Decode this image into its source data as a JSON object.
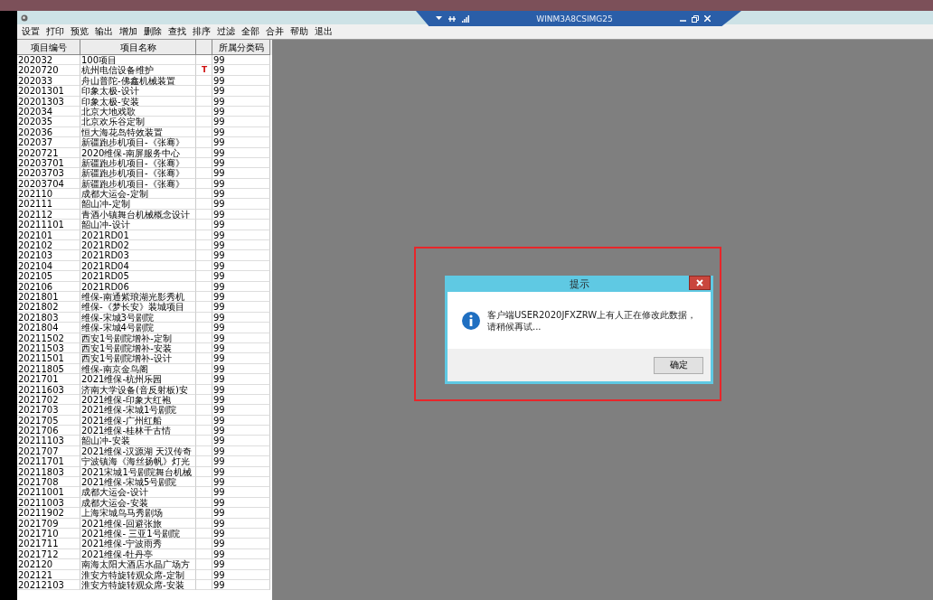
{
  "remote_bar": {
    "title": "WINM3A8CSIMG25"
  },
  "menu": [
    "设置",
    "打印",
    "预览",
    "输出",
    "增加",
    "删除",
    "查找",
    "排序",
    "过滤",
    "全部",
    "合并",
    "帮助",
    "退出"
  ],
  "table": {
    "columns": [
      "项目编号",
      "项目名称",
      "所属分类码"
    ],
    "rows": [
      {
        "code": "202032",
        "name": "100项目",
        "flag": "",
        "category": "99"
      },
      {
        "code": "2020720",
        "name": "杭州电信设备维护",
        "flag": "T",
        "category": "99"
      },
      {
        "code": "202033",
        "name": "舟山普陀-佛鑫机械装置",
        "flag": "",
        "category": "99"
      },
      {
        "code": "20201301",
        "name": "印象太极-设计",
        "flag": "",
        "category": "99"
      },
      {
        "code": "20201303",
        "name": "印象太极-安装",
        "flag": "",
        "category": "99"
      },
      {
        "code": "202034",
        "name": "北京大地戏歌",
        "flag": "",
        "category": "99"
      },
      {
        "code": "202035",
        "name": "北京欢乐谷定制",
        "flag": "",
        "category": "99"
      },
      {
        "code": "202036",
        "name": "恒大海花岛特效装置",
        "flag": "",
        "category": "99"
      },
      {
        "code": "202037",
        "name": "新疆跑步机项目-《张骞》",
        "flag": "",
        "category": "99"
      },
      {
        "code": "2020721",
        "name": "2020维保-南屏服务中心",
        "flag": "",
        "category": "99"
      },
      {
        "code": "20203701",
        "name": "新疆跑步机项目-《张骞》",
        "flag": "",
        "category": "99"
      },
      {
        "code": "20203703",
        "name": "新疆跑步机项目-《张骞》",
        "flag": "",
        "category": "99"
      },
      {
        "code": "20203704",
        "name": "新疆跑步机项目-《张骞》",
        "flag": "",
        "category": "99"
      },
      {
        "code": "202110",
        "name": "成都大运会-定制",
        "flag": "",
        "category": "99"
      },
      {
        "code": "202111",
        "name": "韶山冲-定制",
        "flag": "",
        "category": "99"
      },
      {
        "code": "202112",
        "name": "青酒小镇舞台机械概念设计",
        "flag": "",
        "category": "99"
      },
      {
        "code": "20211101",
        "name": "韶山冲-设计",
        "flag": "",
        "category": "99"
      },
      {
        "code": "202101",
        "name": "2021RD01",
        "flag": "",
        "category": "99"
      },
      {
        "code": "202102",
        "name": "2021RD02",
        "flag": "",
        "category": "99"
      },
      {
        "code": "202103",
        "name": "2021RD03",
        "flag": "",
        "category": "99"
      },
      {
        "code": "202104",
        "name": "2021RD04",
        "flag": "",
        "category": "99"
      },
      {
        "code": "202105",
        "name": "2021RD05",
        "flag": "",
        "category": "99"
      },
      {
        "code": "202106",
        "name": "2021RD06",
        "flag": "",
        "category": "99"
      },
      {
        "code": "2021801",
        "name": "维保-南通紫琅湖光影秀机",
        "flag": "",
        "category": "99"
      },
      {
        "code": "2021802",
        "name": "维保-《梦长安》装城项目",
        "flag": "",
        "category": "99"
      },
      {
        "code": "2021803",
        "name": "维保-宋城3号剧院",
        "flag": "",
        "category": "99"
      },
      {
        "code": "2021804",
        "name": "维保-宋城4号剧院",
        "flag": "",
        "category": "99"
      },
      {
        "code": "20211502",
        "name": "西安1号剧院增补-定制",
        "flag": "",
        "category": "99"
      },
      {
        "code": "20211503",
        "name": "西安1号剧院增补-安装",
        "flag": "",
        "category": "99"
      },
      {
        "code": "20211501",
        "name": "西安1号剧院增补-设计",
        "flag": "",
        "category": "99"
      },
      {
        "code": "20211805",
        "name": "维保-南京金鸟阁",
        "flag": "",
        "category": "99"
      },
      {
        "code": "2021701",
        "name": "2021维保-杭州乐园",
        "flag": "",
        "category": "99"
      },
      {
        "code": "20211603",
        "name": "济南大学设备(音反射板)安",
        "flag": "",
        "category": "99"
      },
      {
        "code": "2021702",
        "name": "2021维保-印象大红袍",
        "flag": "",
        "category": "99"
      },
      {
        "code": "2021703",
        "name": "2021维保-宋城1号剧院",
        "flag": "",
        "category": "99"
      },
      {
        "code": "2021705",
        "name": "2021维保-广州红船",
        "flag": "",
        "category": "99"
      },
      {
        "code": "2021706",
        "name": "2021维保-桂林千古情",
        "flag": "",
        "category": "99"
      },
      {
        "code": "20211103",
        "name": "韶山冲-安装",
        "flag": "",
        "category": "99"
      },
      {
        "code": "2021707",
        "name": "2021维保-汉源湖 天汉传奇",
        "flag": "",
        "category": "99"
      },
      {
        "code": "20211701",
        "name": "宁波镇海《海丝扬帆》灯光",
        "flag": "",
        "category": "99"
      },
      {
        "code": "20211803",
        "name": "2021宋城1号剧院舞台机械",
        "flag": "",
        "category": "99"
      },
      {
        "code": "2021708",
        "name": "2021维保-宋城5号剧院",
        "flag": "",
        "category": "99"
      },
      {
        "code": "20211001",
        "name": "成都大运会-设计",
        "flag": "",
        "category": "99"
      },
      {
        "code": "20211003",
        "name": "成都大运会-安装",
        "flag": "",
        "category": "99"
      },
      {
        "code": "20211902",
        "name": "上海宋城鸟马秀剧场",
        "flag": "",
        "category": "99"
      },
      {
        "code": "2021709",
        "name": "2021维保-回避张旅",
        "flag": "",
        "category": "99"
      },
      {
        "code": "2021710",
        "name": "2021维保- 三亚1号剧院",
        "flag": "",
        "category": "99"
      },
      {
        "code": "2021711",
        "name": "2021维保-宁波雨秀",
        "flag": "",
        "category": "99"
      },
      {
        "code": "2021712",
        "name": "2021维保-牡丹亭",
        "flag": "",
        "category": "99"
      },
      {
        "code": "202120",
        "name": "南海太阳大酒店水晶广场方",
        "flag": "",
        "category": "99"
      },
      {
        "code": "202121",
        "name": "淮安方特旋转观众席-定制",
        "flag": "",
        "category": "99"
      },
      {
        "code": "20212103",
        "name": "淮安方特旋转观众席-安装",
        "flag": "",
        "category": "99"
      }
    ]
  },
  "dialog": {
    "title": "提示",
    "message": "客户端USER2020JFXZRW上有人正在修改此数据，请稍候再试...",
    "button": "确定"
  }
}
